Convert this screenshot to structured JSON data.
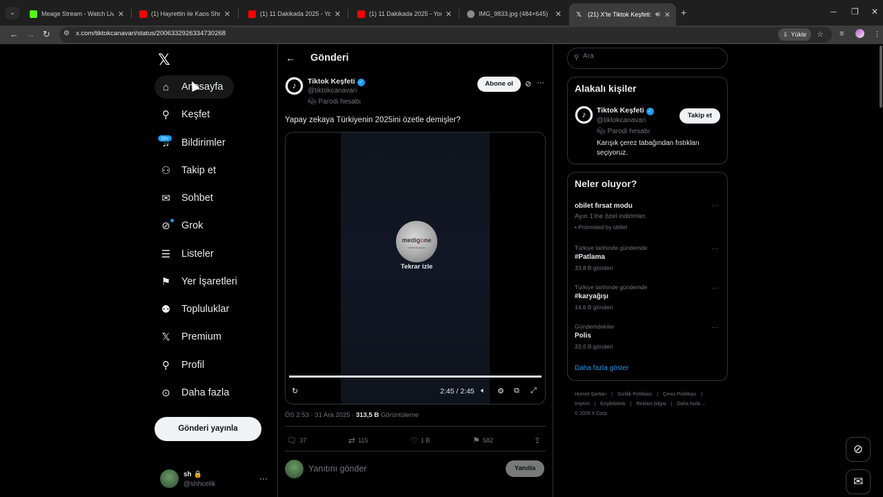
{
  "browser": {
    "tabs": [
      {
        "title": "Meage Stream - Watch Live on",
        "favicon_color": "#53fc18"
      },
      {
        "title": "(1) Hayrettin ile Kaos Show - 2...",
        "favicon_color": "#ff0000"
      },
      {
        "title": "(1) 11 Dakikada 2025 - YouTube",
        "favicon_color": "#ff0000"
      },
      {
        "title": "(1) 11 Dakikada 2025 - YouTube",
        "favicon_color": "#ff0000"
      },
      {
        "title": "IMG_9833.jpg (484×645)",
        "favicon_color": "#8a8a8a"
      },
      {
        "title": "(21) X'te Tiktok Keşfeti: \"Ya...",
        "favicon_color": "#ffffff"
      }
    ],
    "url": "x.com/tiktokcanavari/status/2006332926334730268",
    "install_label": "Yükle"
  },
  "nav": {
    "items": [
      {
        "label": "Anasayfa",
        "icon": "home-icon"
      },
      {
        "label": "Keşfet",
        "icon": "search-icon"
      },
      {
        "label": "Bildirimler",
        "icon": "bell-icon"
      },
      {
        "label": "Takip et",
        "icon": "follow-icon"
      },
      {
        "label": "Sohbet",
        "icon": "mail-icon"
      },
      {
        "label": "Grok",
        "icon": "grok-icon"
      },
      {
        "label": "Listeler",
        "icon": "list-icon"
      },
      {
        "label": "Yer İşaretleri",
        "icon": "bookmark-icon"
      },
      {
        "label": "Topluluklar",
        "icon": "communities-icon"
      },
      {
        "label": "Premium",
        "icon": "x-icon"
      },
      {
        "label": "Profil",
        "icon": "person-icon"
      },
      {
        "label": "Daha fazla",
        "icon": "more-circle-icon"
      }
    ],
    "notifications_badge": "20+",
    "post_button": "Gönderi yayınla",
    "account": {
      "name": "sh 🔒",
      "handle": "@shhcelik"
    }
  },
  "post": {
    "header_title": "Gönderi",
    "author_name": "Tiktok Keşfeti",
    "author_handle": "@tiktokcanavari",
    "parody_label": "Parodi hesabı",
    "subscribe_label": "Abone ol",
    "text": "Yapay zekaya Türkiyenin 2025ini özetle demişler?",
    "video": {
      "logo_text_a": "medig",
      "logo_text_b": "o",
      "logo_text_c": "ne",
      "logo_sub": "medical group",
      "replay_label": "Tekrar izle",
      "time": "2:45 / 2:45",
      "progress": 1.0
    },
    "meta_time": "ÖS 2:53 · 31 Ara 2025 · ",
    "meta_views_count": "313,5 B",
    "meta_views_label": " Görüntüleme",
    "stats": {
      "replies": "37",
      "reposts": "115",
      "likes": "1 B",
      "bookmarks": "582"
    },
    "reply_placeholder": "Yanıtını gönder",
    "reply_button": "Yanıtla"
  },
  "sidebar": {
    "search_placeholder": "Ara",
    "related": {
      "title": "Alakalı kişiler",
      "name": "Tiktok Keşfeti",
      "handle": "@tiktokcanavari",
      "parody_label": "Parodi hesabı",
      "bio": "Karışık çerez tabağından fıstıkları seçiyoruz.",
      "follow_label": "Takip et"
    },
    "trends": {
      "title": "Neler oluyor?",
      "items": [
        {
          "context": "",
          "name": "obilet fırsat modu",
          "sub": "Ayın 1'ine özel indirimler.",
          "count": "Promoted by obilet"
        },
        {
          "context": "Türkiye tarihinde gündemde",
          "name": "#Patlama",
          "sub": "",
          "count": "33,8 B gönderi"
        },
        {
          "context": "Türkiye tarihinde gündemde",
          "name": "#karyağışı",
          "sub": "",
          "count": "14,6 B gönderi"
        },
        {
          "context": "Gündemdekiler",
          "name": "Polis",
          "sub": "",
          "count": "33,6 B gönderi"
        }
      ],
      "show_more": "Daha fazla göster"
    },
    "footer": {
      "links": [
        "Hizmet Şartları",
        "Gizlilik Politikası",
        "Çerez Politikası",
        "Imprint",
        "Erişilebilirlik",
        "Reklam bilgisi",
        "Daha fazla ..."
      ],
      "copyright": "© 2026 X Corp."
    }
  }
}
